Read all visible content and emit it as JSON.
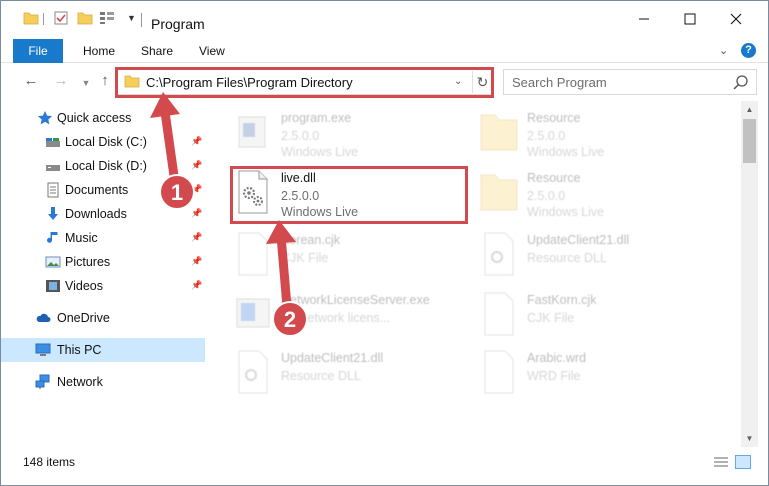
{
  "window": {
    "title": "Program",
    "min_icon": "minimize-icon",
    "max_icon": "maximize-icon",
    "close_icon": "close-icon"
  },
  "ribbon": {
    "tabs": [
      "File",
      "Home",
      "Share",
      "View"
    ]
  },
  "address": {
    "path": "C:\\Program Files\\Program Directory"
  },
  "search": {
    "placeholder": "Search Program"
  },
  "sidebar": {
    "items": [
      {
        "label": "Quick access",
        "icon": "star-icon",
        "pinned": false
      },
      {
        "label": "Local Disk (C:)",
        "icon": "drive-icon",
        "pinned": true
      },
      {
        "label": "Local Disk (D:)",
        "icon": "drive-icon",
        "pinned": true
      },
      {
        "label": "Documents",
        "icon": "documents-icon",
        "pinned": true
      },
      {
        "label": "Downloads",
        "icon": "downloads-icon",
        "pinned": true
      },
      {
        "label": "Music",
        "icon": "music-icon",
        "pinned": true
      },
      {
        "label": "Pictures",
        "icon": "pictures-icon",
        "pinned": true
      },
      {
        "label": "Videos",
        "icon": "videos-icon",
        "pinned": true
      },
      {
        "label": "OneDrive",
        "icon": "onedrive-icon",
        "pinned": false
      },
      {
        "label": "This PC",
        "icon": "pc-icon",
        "pinned": false,
        "selected": true
      },
      {
        "label": "Network",
        "icon": "network-icon",
        "pinned": false
      }
    ]
  },
  "files": [
    {
      "name": "program.exe",
      "line2": "2.5.0.0",
      "line3": "Windows Live",
      "icon": "exe-icon"
    },
    {
      "name": "Resource",
      "line2": "2.5.0.0",
      "line3": "Windows Live",
      "icon": "folder-icon"
    },
    {
      "name": "live.dll",
      "line2": "2.5.0.0",
      "line3": "Windows Live",
      "icon": "dll-icon"
    },
    {
      "name": "Resource",
      "line2": "2.5.0.0",
      "line3": "Windows Live",
      "icon": "folder-icon"
    },
    {
      "name": "Korean.cjk",
      "line2": "CJK File",
      "line3": "",
      "icon": "file-icon"
    },
    {
      "name": "UpdateClient21.dll",
      "line2": "Resource DLL",
      "line3": "",
      "icon": "dll-icon"
    },
    {
      "name": "NetworkLicenseServer.exe",
      "line2": "TV network licens...",
      "line3": "",
      "icon": "exe-icon"
    },
    {
      "name": "FastKorn.cjk",
      "line2": "CJK File",
      "line3": "",
      "icon": "file-icon"
    },
    {
      "name": "UpdateClient21.dll",
      "line2": "Resource DLL",
      "line3": "",
      "icon": "dll-icon"
    },
    {
      "name": "Arabic.wrd",
      "line2": "WRD File",
      "line3": "",
      "icon": "file-icon"
    }
  ],
  "status": {
    "item_count": "148 items"
  },
  "callouts": [
    "1",
    "2"
  ],
  "colors": {
    "accent": "#1979ca",
    "highlight": "#d24a4d",
    "selected": "#cce8ff"
  }
}
